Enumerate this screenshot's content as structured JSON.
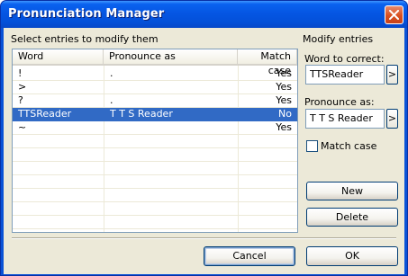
{
  "window": {
    "title": "Pronunciation Manager"
  },
  "left_panel": {
    "label": "Select entries to modify them"
  },
  "table": {
    "columns": [
      "Word",
      "Pronounce as",
      "Match case"
    ],
    "rows": [
      {
        "word": "!",
        "pronounce": ".",
        "match": "Yes",
        "selected": false
      },
      {
        "word": ">",
        "pronounce": "",
        "match": "Yes",
        "selected": false
      },
      {
        "word": "?",
        "pronounce": ".",
        "match": "Yes",
        "selected": false
      },
      {
        "word": "TTSReader",
        "pronounce": "T T S Reader",
        "match": "No",
        "selected": true
      },
      {
        "word": "~",
        "pronounce": "",
        "match": "Yes",
        "selected": false
      }
    ]
  },
  "right_panel": {
    "group_label": "Modify entries",
    "word_label": "Word to correct:",
    "word_value": "TTSReader",
    "word_arrow": ">",
    "pron_label": "Pronounce as:",
    "pron_value": "T T S Reader",
    "pron_arrow": ">",
    "match_label": "Match case",
    "match_checked": false,
    "new_label": "New",
    "delete_label": "Delete"
  },
  "footer": {
    "cancel_label": "Cancel",
    "ok_label": "OK"
  },
  "colors": {
    "titlebar": "#0556e3",
    "selection": "#316ac5",
    "dialog_bg": "#ece9d8",
    "close": "#d9501f"
  },
  "icons": {
    "close": "close-icon"
  }
}
